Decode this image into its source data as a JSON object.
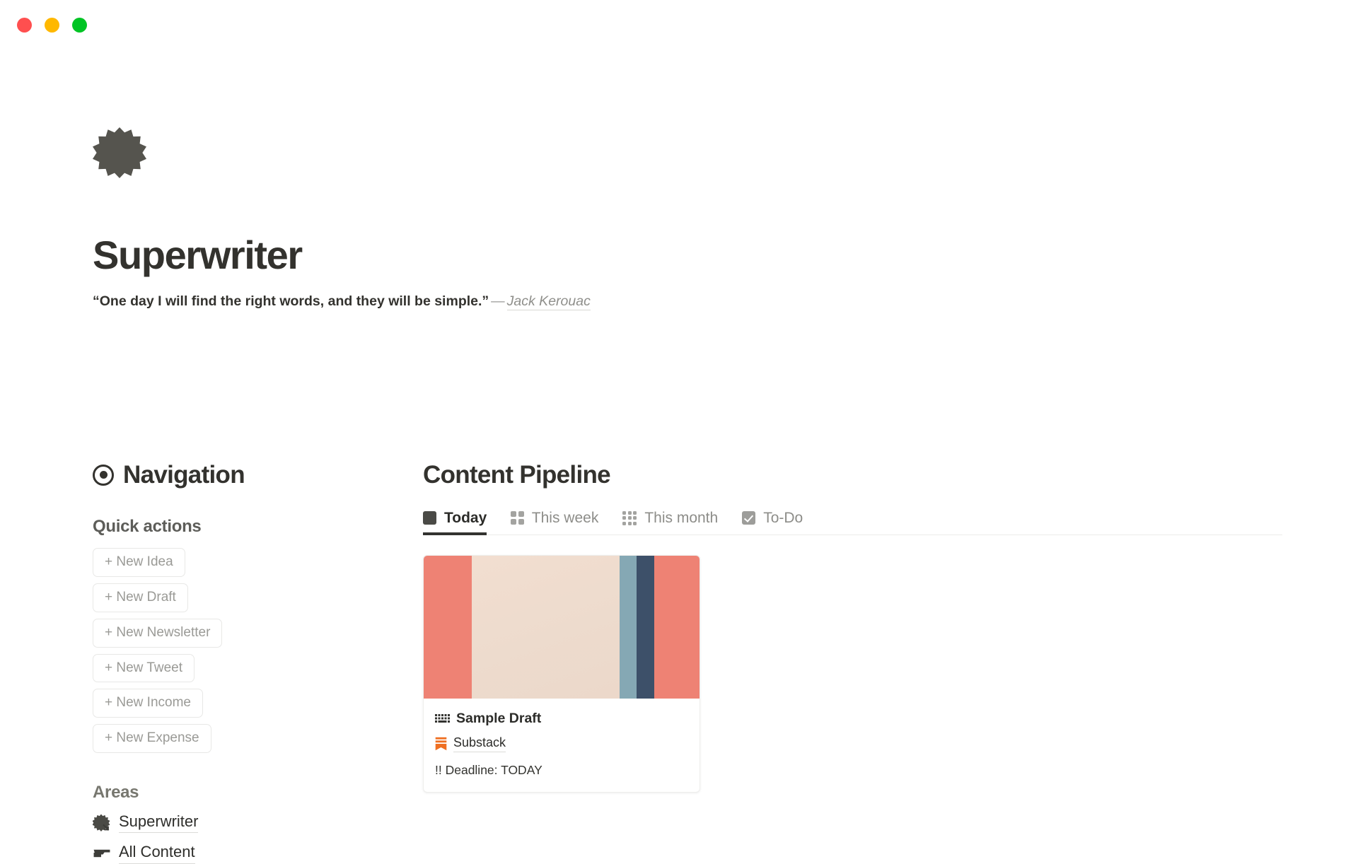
{
  "window": {
    "traffic_lights": [
      {
        "name": "close",
        "color": "#ff4f4f"
      },
      {
        "name": "minimize",
        "color": "#ffb800"
      },
      {
        "name": "maximize",
        "color": "#00c424"
      }
    ]
  },
  "hero": {
    "logo_icon": "burst-star-icon",
    "title": "Superwriter",
    "quote": "“One day I will find the right words, and they will be simple.”",
    "dash": "—",
    "author": "Jack Kerouac"
  },
  "navigation": {
    "icon": "target-circle-icon",
    "title": "Navigation",
    "quick_actions": {
      "heading": "Quick actions",
      "buttons": [
        {
          "label": "+ New Idea"
        },
        {
          "label": "+ New Draft"
        },
        {
          "label": "+ New Newsletter"
        },
        {
          "label": "+ New Tweet"
        },
        {
          "label": "+ New Income"
        },
        {
          "label": "+ New Expense"
        }
      ]
    },
    "areas": {
      "heading": "Areas",
      "items": [
        {
          "label": "Superwriter",
          "icon": "burst-arrow-icon"
        },
        {
          "label": "All Content",
          "icon": "tray-folder-icon"
        }
      ]
    }
  },
  "content_pipeline": {
    "title": "Content Pipeline",
    "tabs": [
      {
        "label": "Today",
        "icon": "filled-square-icon",
        "active": true
      },
      {
        "label": "This week",
        "icon": "grid-2x2-icon",
        "active": false
      },
      {
        "label": "This month",
        "icon": "grid-3x3-icon",
        "active": false
      },
      {
        "label": "To-Do",
        "icon": "checkbox-icon",
        "active": false
      }
    ],
    "cards": [
      {
        "title": "Sample Draft",
        "title_icon": "keyboard-icon",
        "publication": "Substack",
        "publication_icon": "substack-icon",
        "publication_color": "#ef6f22",
        "meta": "!! Deadline: TODAY",
        "cover_colors": [
          "#ee8274",
          "#eddbcd",
          "#85a8b4",
          "#3d5069",
          "#ee8274"
        ]
      }
    ]
  }
}
